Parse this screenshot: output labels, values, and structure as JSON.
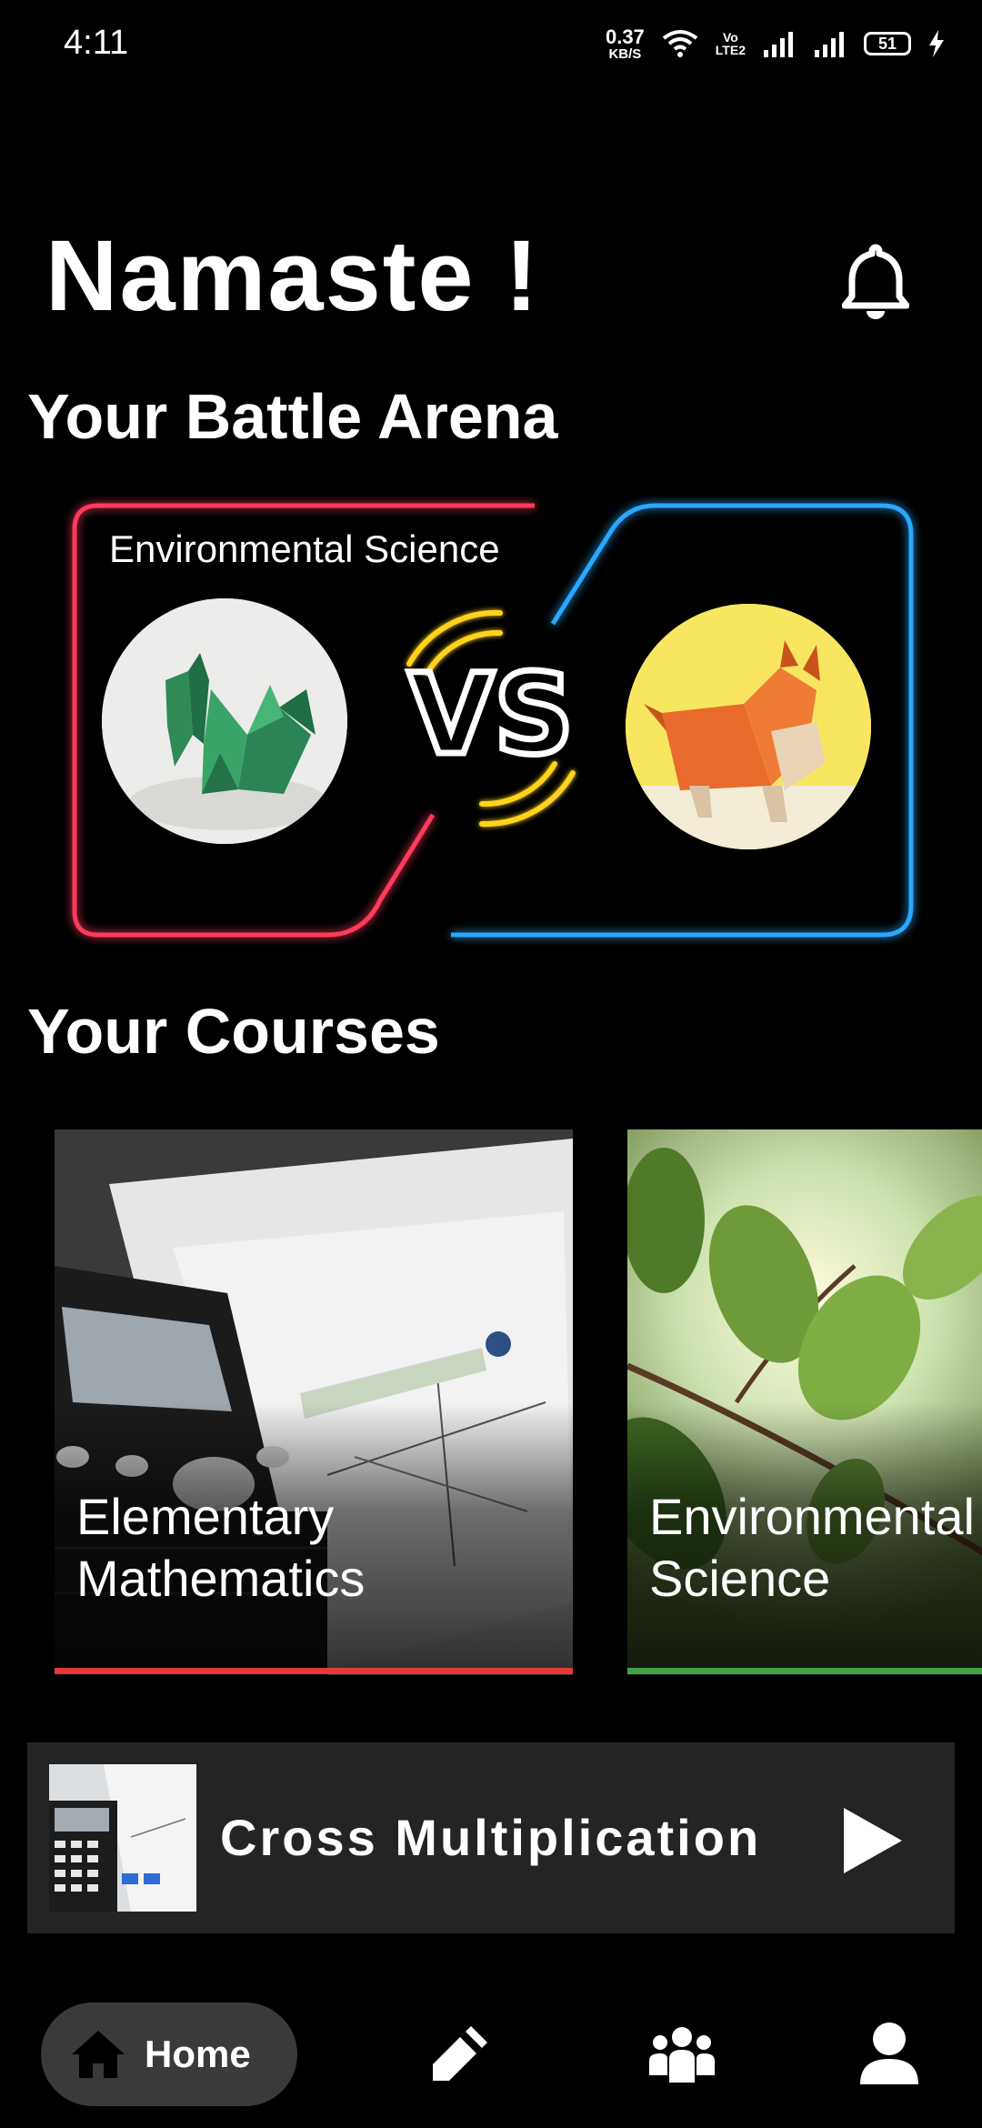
{
  "status_bar": {
    "time": "4:11",
    "speed_value": "0.37",
    "speed_unit": "KB/S",
    "volte_top": "Vo",
    "volte_bottom": "LTE2",
    "battery": "51"
  },
  "header": {
    "greeting": "Namaste !",
    "notifications_icon": "bell-icon"
  },
  "battle": {
    "section_title": "Your Battle Arena",
    "subject": "Environmental Science",
    "versus": "VS",
    "colors": {
      "left_frame": "#ff3b5c",
      "right_frame": "#2aa8ff",
      "vs_ring": "#ffd21e"
    }
  },
  "courses": {
    "section_title": "Your Courses",
    "items": [
      {
        "title": "Elementary\nMathematics",
        "accent": "#e53935"
      },
      {
        "title": "Environmental\nScience",
        "accent": "#43a047"
      }
    ]
  },
  "now_playing": {
    "title": "Cross Multiplication",
    "play_icon": "play-icon"
  },
  "nav": {
    "home_label": "Home",
    "items": [
      "home-icon",
      "pencil-icon",
      "group-icon",
      "profile-icon"
    ]
  }
}
